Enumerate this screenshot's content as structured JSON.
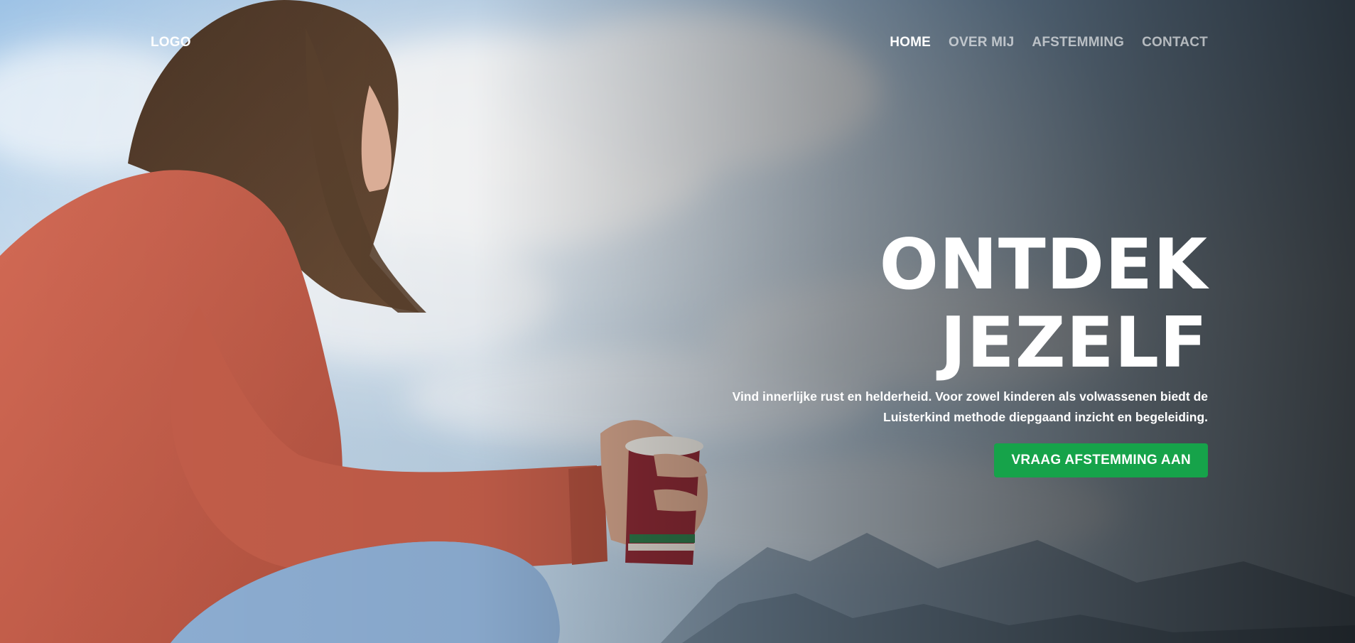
{
  "header": {
    "logo": "LOGO",
    "nav": [
      {
        "label": "HOME",
        "active": true
      },
      {
        "label": "OVER MIJ",
        "active": false
      },
      {
        "label": "AFSTEMMING",
        "active": false
      },
      {
        "label": "CONTACT",
        "active": false
      }
    ]
  },
  "hero": {
    "title": "ONTDEK JEZELF",
    "subtitle": "Vind innerlijke rust en helderheid. Voor zowel kinderen als volwassenen biedt de Luisterkind methode diepgaand inzicht en begeleiding.",
    "cta_label": "VRAAG AFSTEMMING AAN"
  },
  "colors": {
    "cta": "#16a34a",
    "text": "#ffffff",
    "sweater": "#c65f4b",
    "jeans": "#8fb0d6"
  }
}
